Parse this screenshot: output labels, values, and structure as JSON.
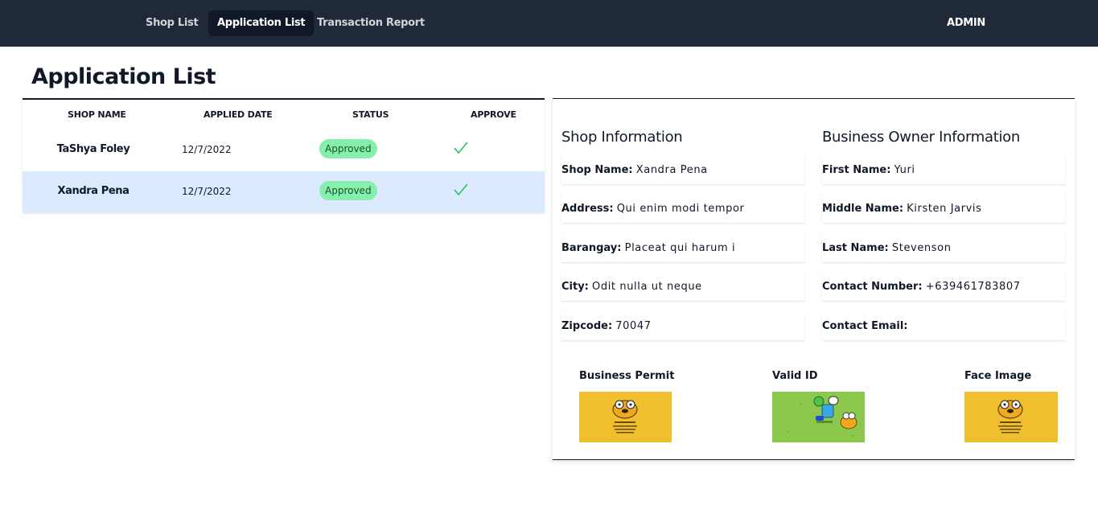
{
  "nav": {
    "items": [
      {
        "label": "Shop List",
        "active": false
      },
      {
        "label": "Application List",
        "active": true
      },
      {
        "label": "Transaction Report",
        "active": false
      }
    ],
    "user_label": "ADMIN"
  },
  "page": {
    "title": "Application List"
  },
  "table": {
    "columns": [
      "SHOP NAME",
      "APPLIED DATE",
      "STATUS",
      "APPROVE"
    ],
    "rows": [
      {
        "shop_name": "TaShya Foley",
        "applied_date": "12/7/2022",
        "status": "Approved",
        "approve_icon": "check-icon",
        "selected": false
      },
      {
        "shop_name": "Xandra Pena",
        "applied_date": "12/7/2022",
        "status": "Approved",
        "approve_icon": "check-icon",
        "selected": true
      }
    ]
  },
  "details": {
    "shop_section_title": "Shop Information",
    "owner_section_title": "Business Owner Information",
    "shop_fields": [
      {
        "label": "Shop Name:",
        "value": "Xandra Pena"
      },
      {
        "label": "Address:",
        "value": "Qui enim modi tempor"
      },
      {
        "label": "Barangay:",
        "value": "Placeat qui harum i"
      },
      {
        "label": "City:",
        "value": "Odit nulla ut neque"
      },
      {
        "label": "Zipcode:",
        "value": "70047"
      }
    ],
    "owner_fields": [
      {
        "label": "First Name:",
        "value": "Yuri"
      },
      {
        "label": "Middle Name:",
        "value": "Kirsten Jarvis"
      },
      {
        "label": "Last Name:",
        "value": "Stevenson"
      },
      {
        "label": "Contact Number:",
        "value": "+639461783807"
      },
      {
        "label": "Contact Email:",
        "value": ""
      }
    ],
    "images": [
      {
        "label": "Business Permit",
        "background": "#efbf2e"
      },
      {
        "label": "Valid ID",
        "background": "#8cc84b"
      },
      {
        "label": "Face Image",
        "background": "#efbf2e"
      }
    ]
  },
  "colors": {
    "navbar": "#1f2937",
    "active_nav": "#111827",
    "badge": "#86efac",
    "check": "#22c55e",
    "selected_row": "#dbeafe"
  }
}
